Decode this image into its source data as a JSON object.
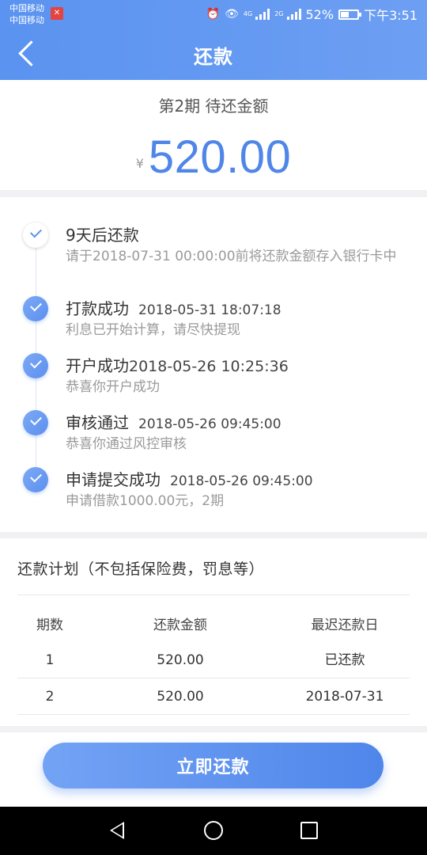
{
  "status_bar": {
    "carrier_1": "中国移动",
    "carrier_2": "中国移动",
    "net_top": "4G",
    "net_top2": "2G",
    "battery": "52%",
    "battery_level": 0.52,
    "time": "下午3:51"
  },
  "header": {
    "title": "还款"
  },
  "amount_card": {
    "label": "第2期 待还金额",
    "currency": "¥",
    "amount": "520.00"
  },
  "timeline": [
    {
      "title": "9天后还款",
      "time": "",
      "desc": "请于2018-07-31 00:00:00前将还款金额存入银行卡中",
      "status": "pending"
    },
    {
      "title": "打款成功",
      "time": "2018-05-31 18:07:18",
      "desc": "利息已开始计算，请尽快提现",
      "status": "done"
    },
    {
      "title": "开户成功",
      "time": "2018-05-26 10:25:36",
      "desc": "恭喜你开户成功",
      "status": "done"
    },
    {
      "title": "审核通过",
      "time": "2018-05-26 09:45:00",
      "desc": "恭喜你通过风控审核",
      "status": "done"
    },
    {
      "title": "申请提交成功",
      "time": "2018-05-26 09:45:00",
      "desc": "申请借款1000.00元，2期",
      "status": "done"
    }
  ],
  "plan": {
    "title": "还款计划（不包括保险费，罚息等）",
    "columns": [
      "期数",
      "还款金额",
      "最迟还款日"
    ],
    "rows": [
      [
        "1",
        "520.00",
        "已还款"
      ],
      [
        "2",
        "520.00",
        "2018-07-31"
      ]
    ]
  },
  "action": {
    "pay_label": "立即还款"
  },
  "colors": {
    "accent": "#4f86e8",
    "header": "#5a93f0"
  }
}
